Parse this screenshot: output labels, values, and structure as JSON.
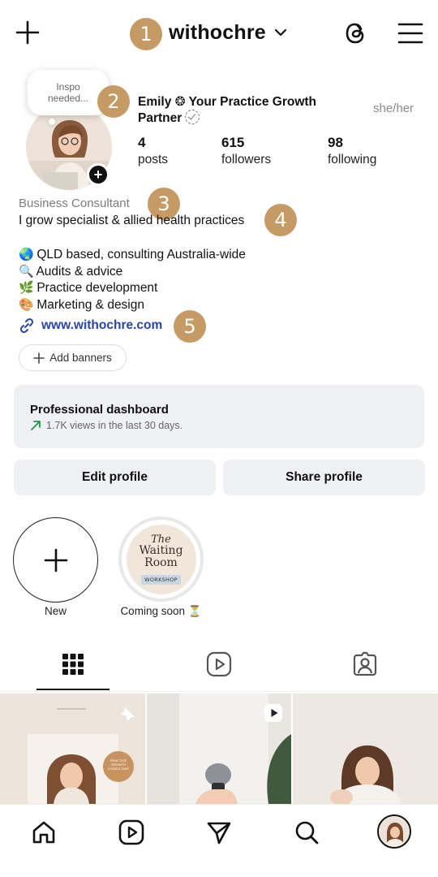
{
  "header": {
    "username": "withochre",
    "new_post_icon": "plus-icon",
    "threads_icon": "threads-icon",
    "menu_icon": "hamburger-menu-icon"
  },
  "annotations": [
    "1",
    "2",
    "3",
    "4",
    "5"
  ],
  "note": {
    "text_line1": "Inspo",
    "text_line2": "needed..."
  },
  "profile": {
    "full_name_line1": "Emily ❂ Your Practice Growth",
    "full_name_line2": "Partner",
    "pronouns": "she/her",
    "stats": [
      {
        "value": "4",
        "label": "posts"
      },
      {
        "value": "615",
        "label": "followers"
      },
      {
        "value": "98",
        "label": "following"
      }
    ],
    "category": "Business Consultant",
    "bio_lines": [
      {
        "emoji": "🌏",
        "text": "I grow specialist & allied health practices"
      },
      {
        "emoji": "🌏",
        "text": "QLD based, consulting Australia-wide"
      },
      {
        "emoji": "🔍",
        "text": "Audits & advice"
      },
      {
        "emoji": "🌿",
        "text": "Practice development"
      },
      {
        "emoji": "🎨",
        "text": "Marketing & design"
      }
    ],
    "website": "www.withochre.com",
    "add_banners": "Add banners"
  },
  "dashboard": {
    "title": "Professional dashboard",
    "subtitle": "1.7K views in the last 30 days."
  },
  "buttons": {
    "edit": "Edit profile",
    "share": "Share profile"
  },
  "highlights": [
    {
      "label": "New"
    },
    {
      "label": "Coming soon ⏳",
      "cover_line1": "The",
      "cover_line2": "Waiting",
      "cover_line3": "Room",
      "cover_tag": "WORKSHOP"
    }
  ],
  "grid_tabs": [
    "grid-icon",
    "reels-icon",
    "tagged-icon"
  ],
  "posts": [
    {
      "overlay_text": "PRACTICE GROWTH CONSULTANT",
      "pinned": true
    },
    {
      "reel": true
    },
    {}
  ],
  "bottom_nav": [
    "home-icon",
    "reels-icon",
    "direct-message-icon",
    "search-icon",
    "profile-avatar"
  ],
  "colors": {
    "badge": "#c69a64",
    "link": "#2845a8",
    "panel": "#eff0f3",
    "green_arrow": "#1a9b4b"
  }
}
